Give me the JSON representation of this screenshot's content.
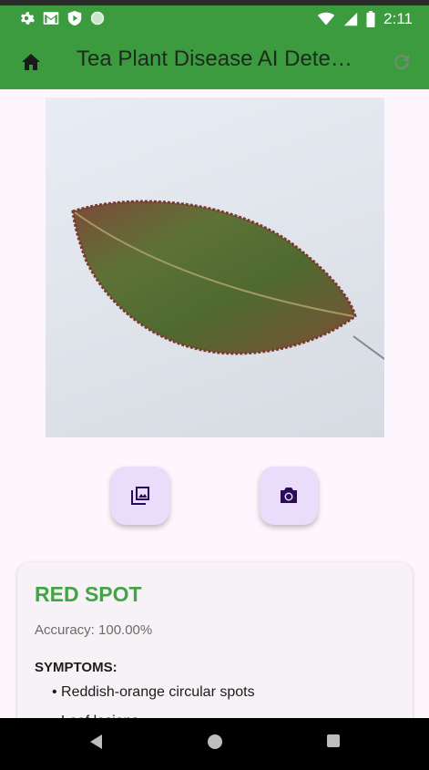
{
  "status_bar": {
    "time": "2:11",
    "left_icons": [
      "settings-icon",
      "gmail-icon",
      "shield-play-icon",
      "circle-icon"
    ],
    "right_icons": [
      "wifi-icon",
      "signal-icon",
      "battery-icon"
    ]
  },
  "app_bar": {
    "title": "Tea Plant Disease AI  Dete…",
    "home_icon": "home-icon",
    "refresh_icon": "refresh-icon",
    "background_color": "#3c9b3e"
  },
  "image_preview": {
    "subject": "tea leaf"
  },
  "actions": {
    "gallery_icon": "photo-library-icon",
    "camera_icon": "camera-icon",
    "button_color": "#eadcfb",
    "icon_color": "#2b0a5a"
  },
  "result": {
    "disease_name": "RED SPOT",
    "accuracy": "Accuracy: 100.00%",
    "symptoms_heading": "SYMPTOMS:",
    "symptoms": [
      "Reddish-orange circular spots",
      "Leaf lesions"
    ],
    "name_color": "#43a447"
  },
  "nav_bar": {
    "buttons": [
      "back-icon",
      "home-circle-icon",
      "recents-icon"
    ]
  }
}
